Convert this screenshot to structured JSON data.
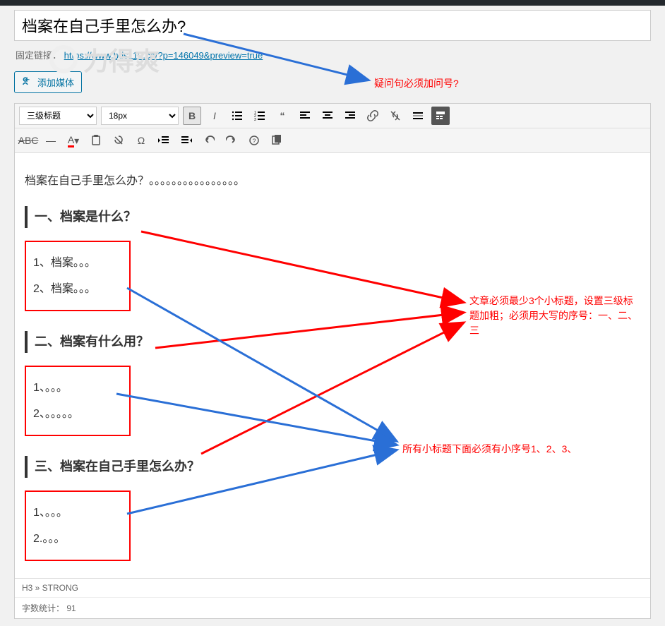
{
  "title_input": "档案在自己手里怎么办?",
  "permalink": {
    "label": "固定链接：",
    "url": "https://www.bds110.cn/?p=146049&preview=true"
  },
  "add_media_label": "添加媒体",
  "watermark_text": "力得爽",
  "toolbar": {
    "heading_select": "三级标题",
    "fontsize_select": "18px"
  },
  "content": {
    "intro": "档案在自己手里怎么办？。。。。。。。。。。。。。。。。",
    "h1": "一、档案是什么？",
    "box1_line1": "1、档案。。。",
    "box1_line2": "2、档案。。。",
    "h2": "二、档案有什么用？",
    "box2_line1": "1、。。。",
    "box2_line2": "2、。。。。。",
    "h3": "三、档案在自己手里怎么办？",
    "box3_line1": "1、。。。",
    "box3_line2": "2.。。。"
  },
  "status": {
    "path": "H3 » STRONG",
    "wordcount_label": "字数统计：",
    "wordcount_value": "91"
  },
  "annotations": {
    "a1": "疑问句必须加问号?",
    "a2": "文章必须最少3个小标题，设置三级标题加粗；必须用大写的序号：一、二、三",
    "a3": "所有小标题下面必须有小序号1、2、3、"
  },
  "icons": {
    "media": "media-icon"
  }
}
